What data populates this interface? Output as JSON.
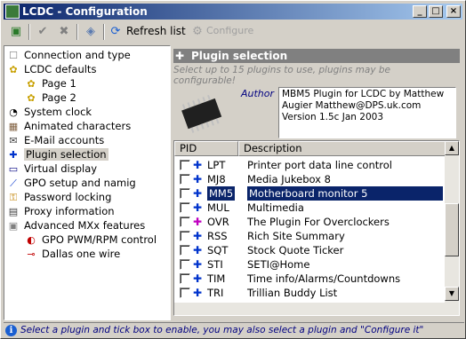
{
  "window": {
    "title": "LCDC - Configuration"
  },
  "toolbar": {
    "refresh_label": "Refresh list",
    "configure_label": "Configure"
  },
  "tree": {
    "items": [
      {
        "label": "Connection and type"
      },
      {
        "label": "LCDC defaults"
      },
      {
        "label": "Page 1"
      },
      {
        "label": "Page 2"
      },
      {
        "label": "System clock"
      },
      {
        "label": "Animated characters"
      },
      {
        "label": "E-Mail accounts"
      },
      {
        "label": "Plugin selection"
      },
      {
        "label": "Virtual display"
      },
      {
        "label": "GPO setup and namig"
      },
      {
        "label": "Password locking"
      },
      {
        "label": "Proxy information"
      },
      {
        "label": "Advanced MXx features"
      },
      {
        "label": "GPO PWM/RPM control"
      },
      {
        "label": "Dallas one wire"
      }
    ]
  },
  "panel": {
    "title": "Plugin selection",
    "subtitle": "Select up to 15 plugins to use, plugins may be configurable!",
    "author_label": "Author",
    "author_text": "MBM5 Plugin for LCDC by Matthew Augier Matthew@DPS.uk.com Version 1.5c Jan 2003"
  },
  "list": {
    "columns": [
      "PID",
      "Description"
    ],
    "rows": [
      {
        "pid": "LPT",
        "desc": "Printer port data line control"
      },
      {
        "pid": "MJ8",
        "desc": "Media Jukebox 8"
      },
      {
        "pid": "MM5",
        "desc": "Motherboard monitor 5"
      },
      {
        "pid": "MUL",
        "desc": "Multimedia"
      },
      {
        "pid": "OVR",
        "desc": "The Plugin For Overclockers"
      },
      {
        "pid": "RSS",
        "desc": "Rich Site Summary"
      },
      {
        "pid": "SQT",
        "desc": "Stock Quote Ticker"
      },
      {
        "pid": "STI",
        "desc": "SETI@Home"
      },
      {
        "pid": "TIM",
        "desc": "Time info/Alarms/Countdowns"
      },
      {
        "pid": "TRI",
        "desc": "Trillian Buddy List"
      }
    ]
  },
  "status": {
    "text": "Select a plugin and tick box to enable, you may also select a plugin and \"Configure it\""
  },
  "colors": {
    "title_start": "#0a246a",
    "title_end": "#a6caf0",
    "selection": "#0a246a"
  }
}
